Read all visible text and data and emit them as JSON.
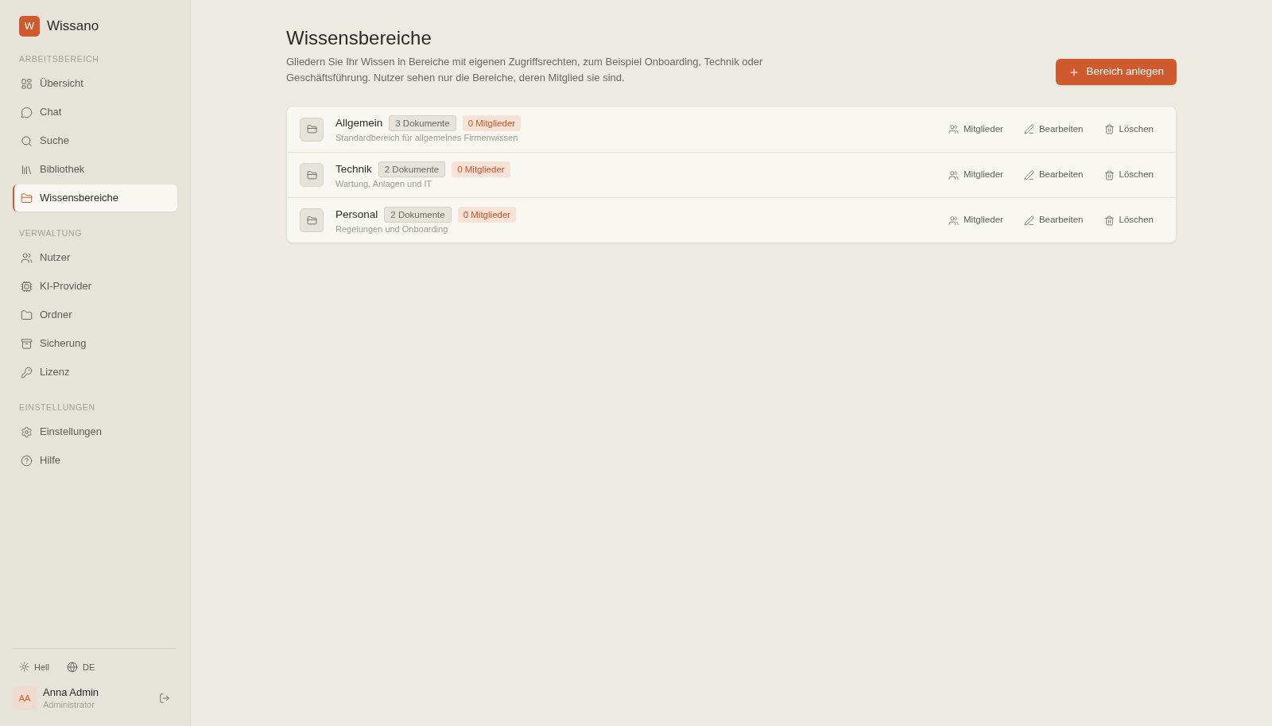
{
  "sidebar": {
    "logo": {
      "letter": "W",
      "name": "Wissano"
    },
    "sections": [
      {
        "title": "ARBEITSBEREICH",
        "items": [
          {
            "label": "Übersicht",
            "selected": false
          },
          {
            "label": "Chat",
            "selected": false
          },
          {
            "label": "Suche",
            "selected": false
          },
          {
            "label": "Bibliothek",
            "selected": false
          },
          {
            "label": "Wissensbereiche",
            "selected": true
          }
        ]
      },
      {
        "title": "VERWALTUNG",
        "items": [
          {
            "label": "Nutzer",
            "selected": false
          },
          {
            "label": "KI-Provider",
            "selected": false
          },
          {
            "label": "Ordner",
            "selected": false
          },
          {
            "label": "Sicherung",
            "selected": false
          },
          {
            "label": "Lizenz",
            "selected": false
          }
        ]
      },
      {
        "title": "EINSTELLUNGEN",
        "items": [
          {
            "label": "Einstellungen",
            "selected": false
          },
          {
            "label": "Hilfe",
            "selected": false
          }
        ]
      }
    ],
    "footer": {
      "theme": "Hell",
      "language": "DE",
      "user": {
        "initials": "AA",
        "name": "Anna Admin",
        "role": "Administrator"
      }
    }
  },
  "main": {
    "title": "Wissensbereiche",
    "description": "Gliedern Sie Ihr Wissen in Bereiche mit eigenen Zugriffsrechten, zum Beispiel Onboarding, Technik oder Geschäftsführung. Nutzer sehen nur die Bereiche, deren Mitglied sie sind.",
    "create_button": "Bereich anlegen",
    "areas": [
      {
        "name": "Allgemein",
        "documents": "3 Dokumente",
        "members": "0 Mitglieder",
        "description": "Standardbereich für allgemeines Firmenwissen",
        "actions": [
          "Mitglieder",
          "Bearbeiten",
          "Löschen"
        ]
      },
      {
        "name": "Technik",
        "documents": "2 Dokumente",
        "members": "0 Mitglieder",
        "description": "Wartung, Anlagen und IT",
        "actions": [
          "Mitglieder",
          "Bearbeiten",
          "Löschen"
        ]
      },
      {
        "name": "Personal",
        "documents": "2 Dokumente",
        "members": "0 Mitglieder",
        "description": "Regelungen und Onboarding",
        "actions": [
          "Mitglieder",
          "Bearbeiten",
          "Löschen"
        ]
      }
    ]
  }
}
